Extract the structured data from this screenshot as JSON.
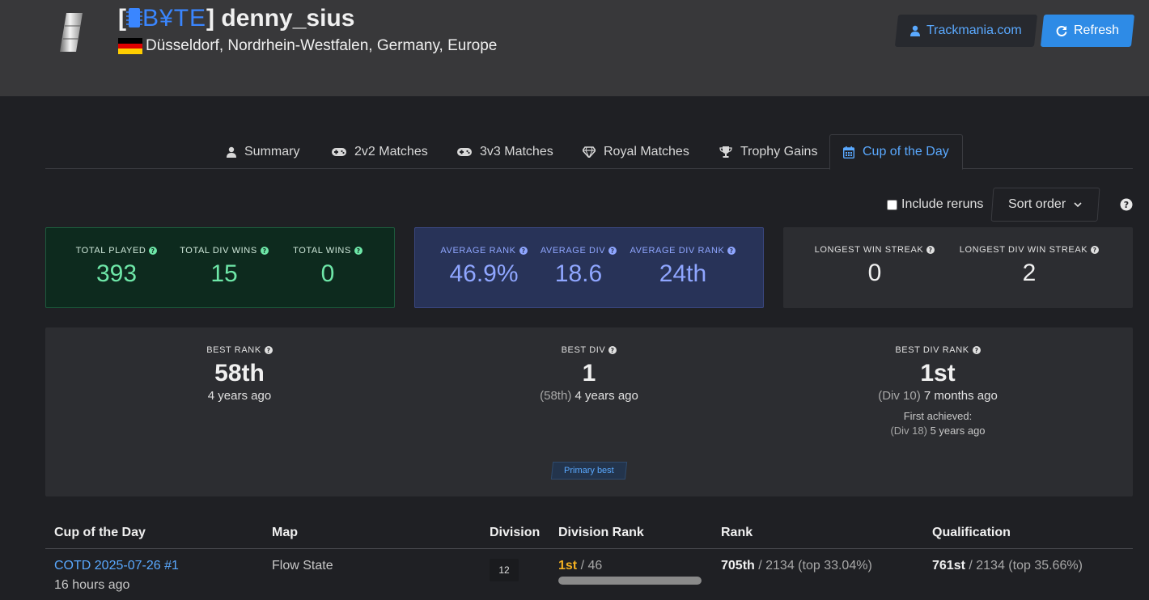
{
  "player": {
    "club_tag_open": "[",
    "club_tag": "B¥TE",
    "club_tag_close": "]",
    "name": "denny_sius",
    "location": "Düsseldorf, Nordrhein-Westfalen, Germany, Europe",
    "flag_colors": [
      "#000000",
      "#dd0000",
      "#ffce00"
    ]
  },
  "header_buttons": {
    "trackmania": "Trackmania.com",
    "refresh": "Refresh"
  },
  "tabs": [
    {
      "label": "Summary",
      "icon": "user-icon"
    },
    {
      "label": "2v2 Matches",
      "icon": "gamepad-icon"
    },
    {
      "label": "3v3 Matches",
      "icon": "gamepad-icon"
    },
    {
      "label": "Royal Matches",
      "icon": "diamond-icon"
    },
    {
      "label": "Trophy Gains",
      "icon": "trophy-icon"
    },
    {
      "label": "Cup of the Day",
      "icon": "calendar-icon",
      "active": true
    }
  ],
  "controls": {
    "include_reruns": "Include reruns",
    "include_reruns_checked": false,
    "sort_order": "Sort order"
  },
  "stats_green": [
    {
      "label": "TOTAL PLAYED",
      "value": "393"
    },
    {
      "label": "TOTAL DIV WINS",
      "value": "15"
    },
    {
      "label": "TOTAL WINS",
      "value": "0"
    }
  ],
  "stats_blue": [
    {
      "label": "AVERAGE RANK",
      "value": "46.9%"
    },
    {
      "label": "AVERAGE DIV",
      "value": "18.6"
    },
    {
      "label": "AVERAGE DIV RANK",
      "value": "24th"
    }
  ],
  "stats_gray": [
    {
      "label": "LONGEST WIN STREAK",
      "value": "0"
    },
    {
      "label": "LONGEST DIV WIN STREAK",
      "value": "2"
    }
  ],
  "best": {
    "rank": {
      "label": "BEST RANK",
      "value": "58th",
      "sub": "4 years ago"
    },
    "div": {
      "label": "BEST DIV",
      "value": "1",
      "sub_muted": "(58th)",
      "sub": "4 years ago"
    },
    "div_rank": {
      "label": "BEST DIV RANK",
      "value": "1st",
      "sub_muted": "(Div 10)",
      "sub": "7 months ago",
      "first_label": "First achieved:",
      "first_muted": "(Div 18)",
      "first_time": "5 years ago"
    },
    "primary_badge": "Primary best"
  },
  "table": {
    "headers": {
      "cotd": "Cup of the Day",
      "map": "Map",
      "division": "Division",
      "division_rank": "Division Rank",
      "rank": "Rank",
      "qualification": "Qualification"
    },
    "rows": [
      {
        "cotd": "COTD 2025-07-26 #1",
        "time": "16 hours ago",
        "map": "Flow State",
        "division": "12",
        "div_rank": "1st",
        "div_total": " / 46",
        "div_progress": 1.0,
        "rank": "705th",
        "rank_rest": " / 2134 (top 33.04%)",
        "qual": "761st",
        "qual_rest": " / 2134 (top 35.66%)"
      }
    ]
  }
}
